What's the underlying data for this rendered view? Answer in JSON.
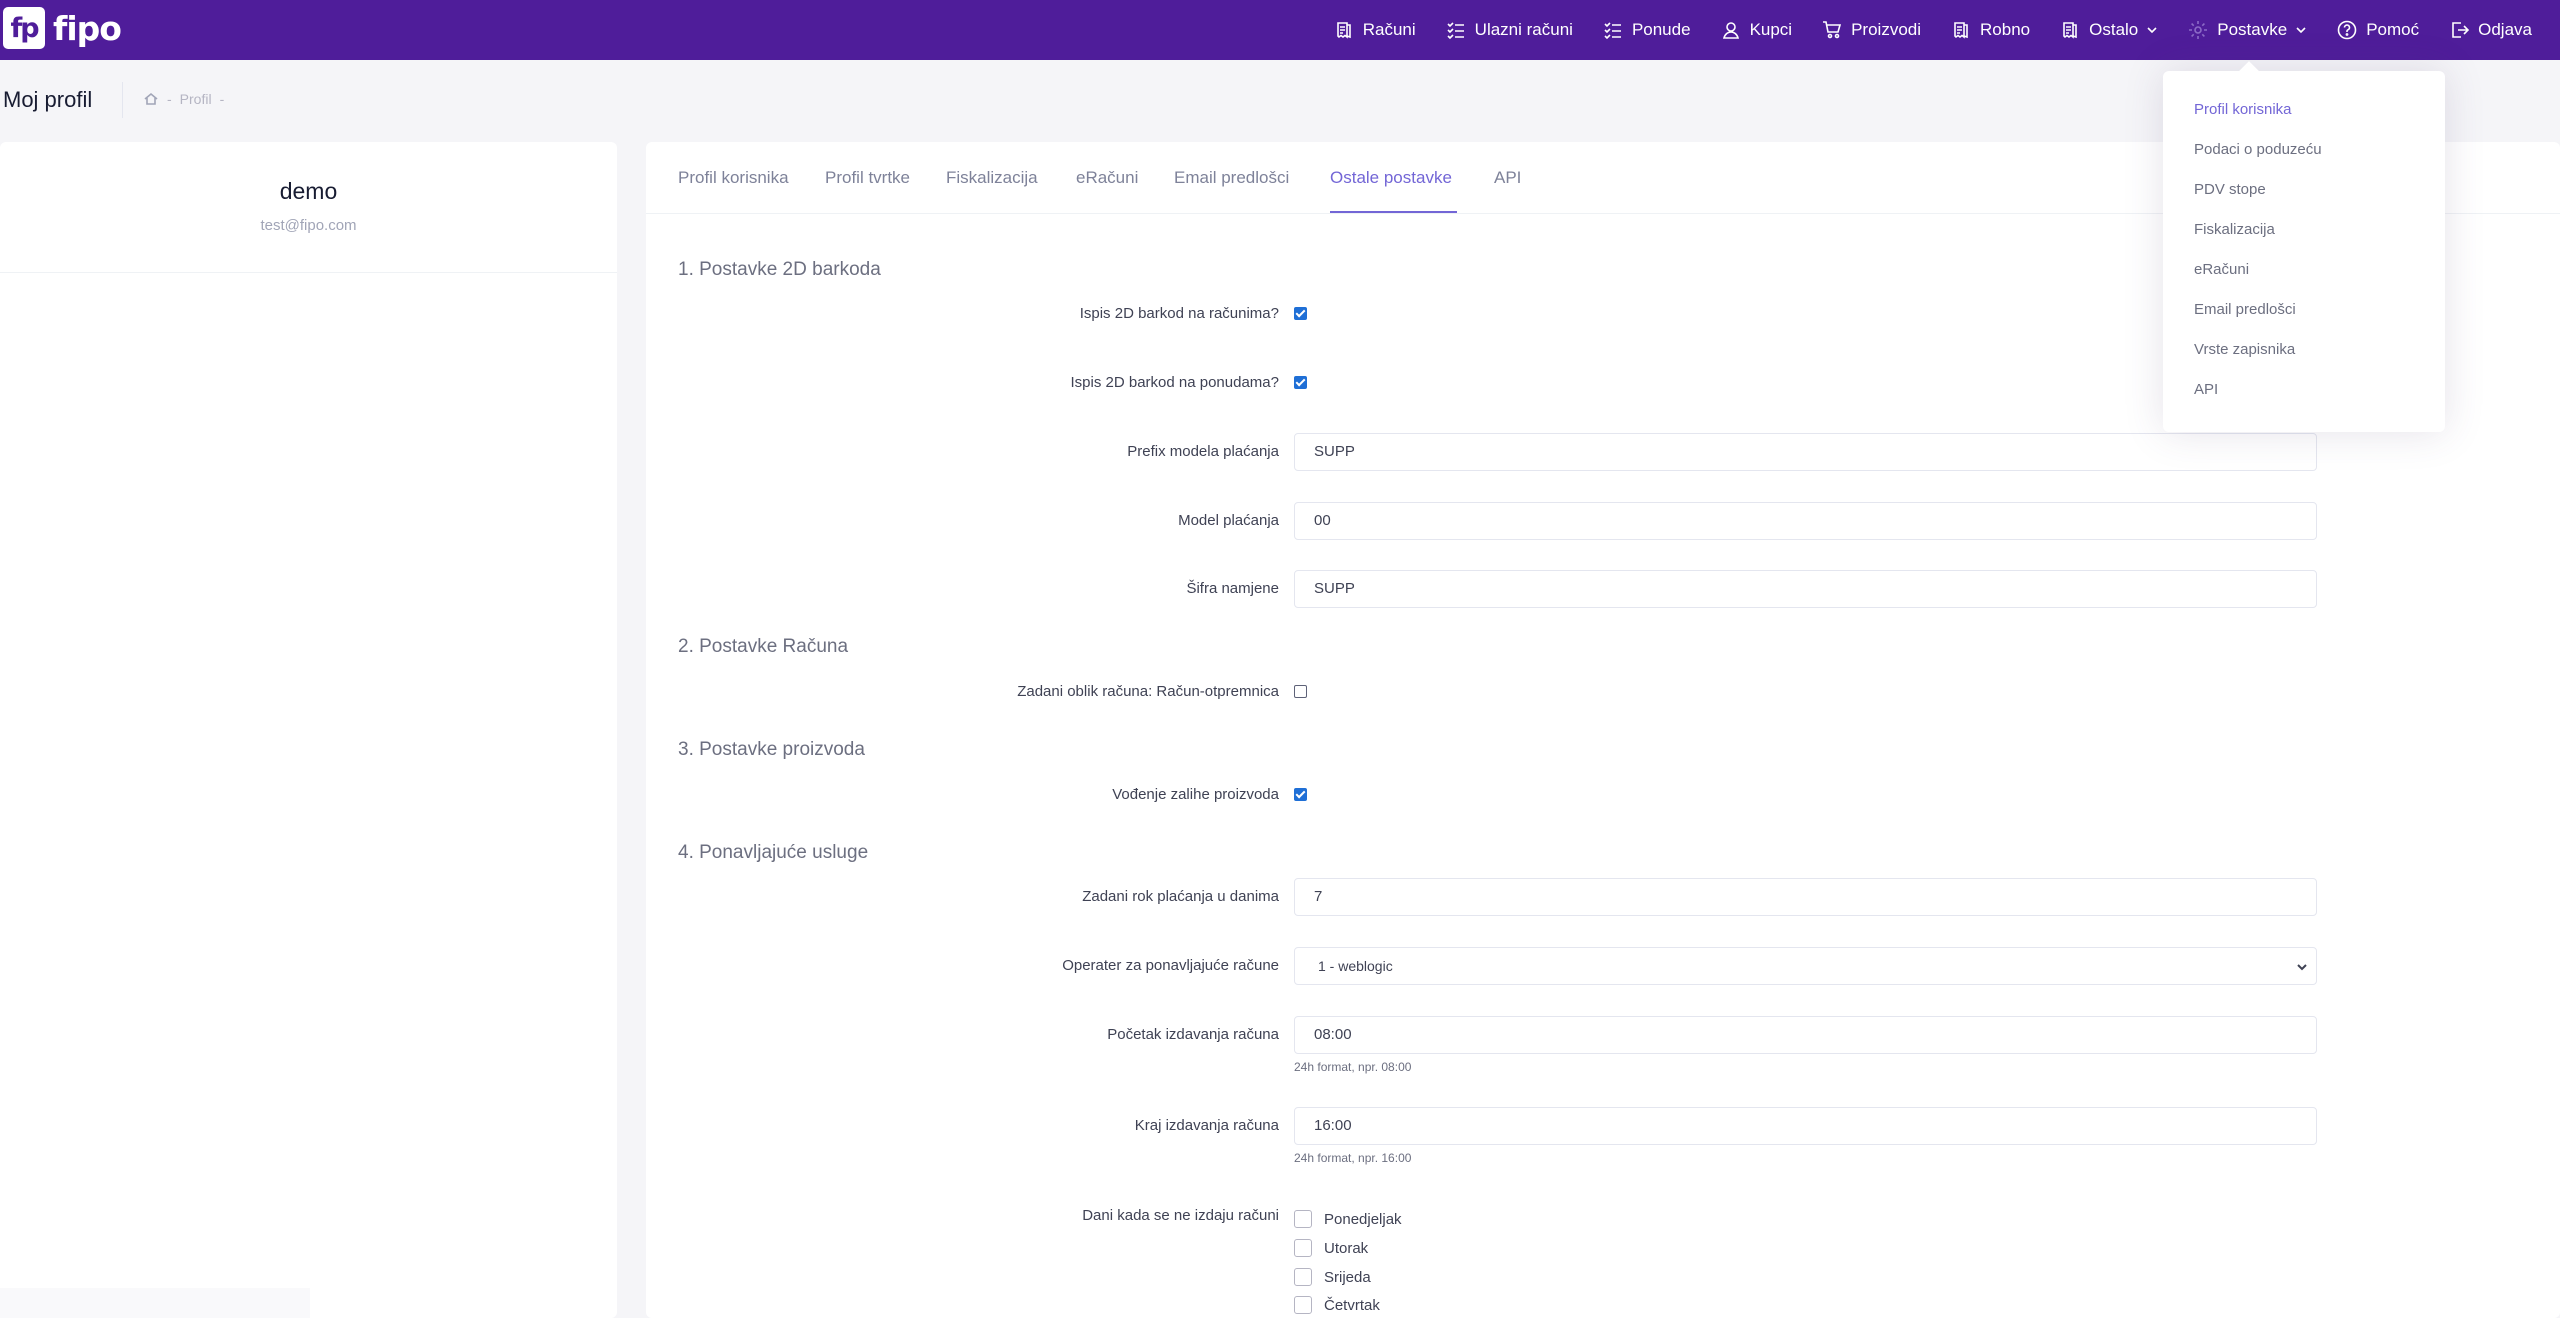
{
  "app": {
    "logo_mark": "fp",
    "logo_text": "fipo"
  },
  "nav": {
    "items": [
      {
        "label": "Računi",
        "icon": "receipt-icon"
      },
      {
        "label": "Ulazni računi",
        "icon": "checklist-icon"
      },
      {
        "label": "Ponude",
        "icon": "checklist-icon"
      },
      {
        "label": "Kupci",
        "icon": "user-icon"
      },
      {
        "label": "Proizvodi",
        "icon": "cart-icon"
      },
      {
        "label": "Robno",
        "icon": "receipt-icon"
      },
      {
        "label": "Ostalo",
        "icon": "receipt-icon"
      },
      {
        "label": "Postavke",
        "icon": "gear-icon"
      },
      {
        "label": "Pomoć",
        "icon": "help-icon"
      },
      {
        "label": "Odjava",
        "icon": "logout-icon"
      }
    ]
  },
  "header": {
    "title": "Moj profil",
    "breadcrumb": "Profil"
  },
  "profile": {
    "name": "demo",
    "email": "test@fipo.com"
  },
  "tabs": [
    {
      "label": "Profil korisnika"
    },
    {
      "label": "Profil tvrtke"
    },
    {
      "label": "Fiskalizacija"
    },
    {
      "label": "eRačuni"
    },
    {
      "label": "Email predlošci"
    },
    {
      "label": "Ostale postavke",
      "active": true
    },
    {
      "label": "API"
    }
  ],
  "sections": {
    "s1": "1. Postavke 2D barkoda",
    "s2": "2. Postavke Računa",
    "s3": "3. Postavke proizvoda",
    "s4": "4. Ponavljajuće usluge"
  },
  "fields": {
    "barcode_invoices": {
      "label": "Ispis 2D barkod na računima?",
      "checked": true
    },
    "barcode_offers": {
      "label": "Ispis 2D barkod na ponudama?",
      "checked": true
    },
    "payment_model_prefix": {
      "label": "Prefix modela plaćanja",
      "value": "SUPP"
    },
    "payment_model": {
      "label": "Model plaćanja",
      "value": "00"
    },
    "purpose_code": {
      "label": "Šifra namjene",
      "value": "SUPP"
    },
    "default_invoice_form": {
      "label": "Zadani oblik računa: Račun-otpremnica",
      "checked": false
    },
    "track_stock": {
      "label": "Vođenje zalihe proizvoda",
      "checked": true
    },
    "payment_due_days": {
      "label": "Zadani rok plaćanja u danima",
      "value": "7"
    },
    "recurring_operator": {
      "label": "Operater za ponavljajuće račune",
      "value": "1 - weblogic"
    },
    "issue_start": {
      "label": "Početak izdavanja računa",
      "value": "08:00",
      "hint": "24h format, npr. 08:00"
    },
    "issue_end": {
      "label": "Kraj izdavanja računa",
      "value": "16:00",
      "hint": "24h format, npr. 16:00"
    },
    "no_issue_days": {
      "label": "Dani kada se ne izdaju računi",
      "days": [
        "Ponedjeljak",
        "Utorak",
        "Srijeda",
        "Četvrtak"
      ]
    }
  },
  "dropdown": {
    "items": [
      {
        "label": "Profil korisnika",
        "active": true
      },
      {
        "label": "Podaci o poduzeću"
      },
      {
        "label": "PDV stope"
      },
      {
        "label": "Fiskalizacija"
      },
      {
        "label": "eRačuni"
      },
      {
        "label": "Email predlošci"
      },
      {
        "label": "Vrste zapisnika"
      },
      {
        "label": "API"
      }
    ]
  },
  "colors": {
    "brand": "#4f1d9a",
    "accent": "#7366d6",
    "checkbox": "#1f6fd6"
  }
}
